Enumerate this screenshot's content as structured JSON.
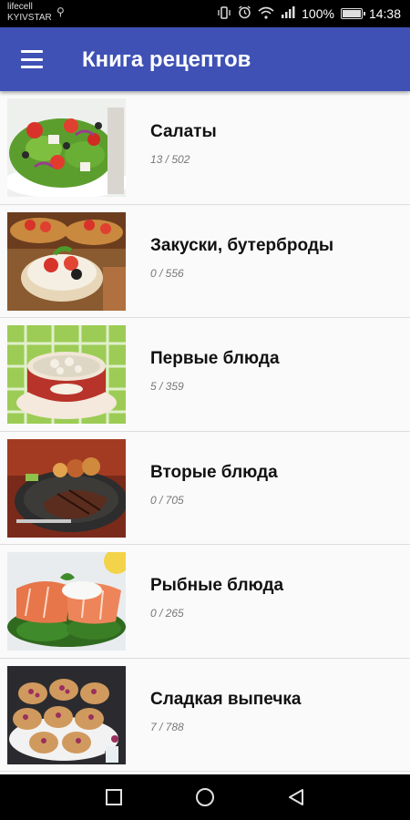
{
  "status_bar": {
    "carrier_line1": "lifecell",
    "carrier_line2": "KYIVSTAR",
    "battery_text": "100%",
    "battery_level": 1.0,
    "time": "14:38",
    "icons": [
      "usb-icon",
      "vibrate-icon",
      "alarm-icon",
      "wifi-icon",
      "signal-icon",
      "battery-icon"
    ]
  },
  "app_bar": {
    "title": "Книга рецептов",
    "menu_icon": "hamburger-menu-icon",
    "color": "#3f51b5"
  },
  "categories": [
    {
      "title": "Салаты",
      "count": "13 / 502",
      "image": "salad-photo"
    },
    {
      "title": "Закуски, бутерброды",
      "count": "0 / 556",
      "image": "sandwiches-photo"
    },
    {
      "title": "Первые блюда",
      "count": "5 / 359",
      "image": "soup-photo"
    },
    {
      "title": "Вторые блюда",
      "count": "0 / 705",
      "image": "steak-photo"
    },
    {
      "title": "Рыбные блюда",
      "count": "0 / 265",
      "image": "salmon-photo"
    },
    {
      "title": "Сладкая выпечка",
      "count": "7 / 788",
      "image": "muffins-photo"
    }
  ],
  "nav_bar": {
    "icons": [
      "recent-apps-icon",
      "home-icon",
      "back-icon"
    ]
  }
}
